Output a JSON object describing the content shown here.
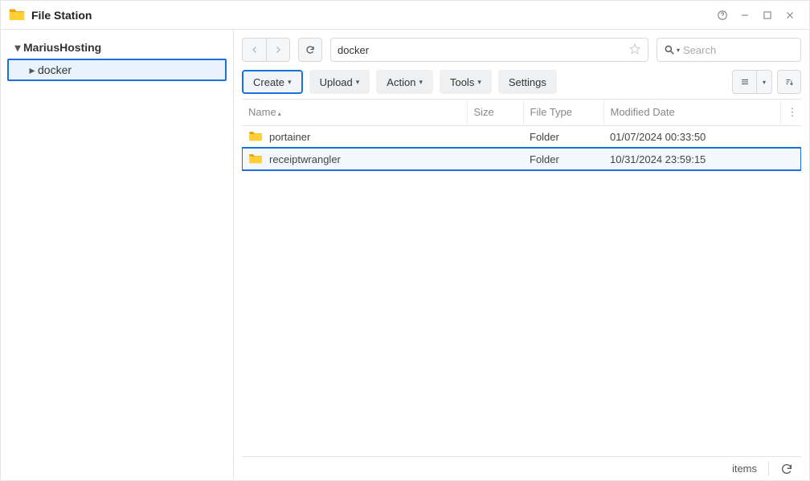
{
  "window": {
    "title": "File Station"
  },
  "tree": {
    "root": "MariusHosting",
    "child": "docker"
  },
  "path": {
    "value": "docker"
  },
  "search": {
    "placeholder": "Search"
  },
  "toolbar": {
    "create": "Create",
    "upload": "Upload",
    "action": "Action",
    "tools": "Tools",
    "settings": "Settings"
  },
  "columns": {
    "name": "Name",
    "size": "Size",
    "type": "File Type",
    "modified": "Modified Date"
  },
  "rows": [
    {
      "name": "portainer",
      "size": "",
      "type": "Folder",
      "modified": "01/07/2024 00:33:50",
      "selected": false
    },
    {
      "name": "receiptwrangler",
      "size": "",
      "type": "Folder",
      "modified": "10/31/2024 23:59:15",
      "selected": true
    }
  ],
  "status": {
    "items_label": "items"
  }
}
